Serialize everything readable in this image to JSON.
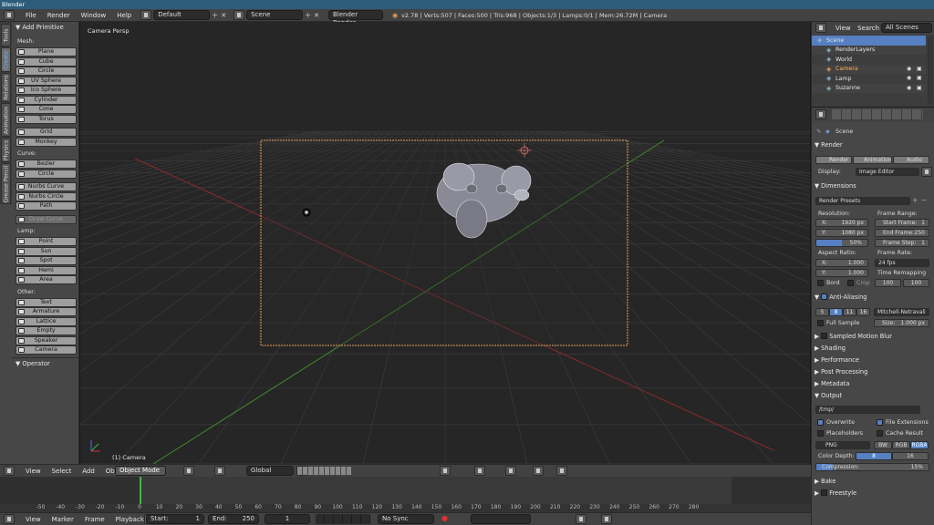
{
  "title": "Blender",
  "infobar": {
    "menus": [
      "File",
      "Render",
      "Window",
      "Help"
    ],
    "layout": "Default",
    "scene": "Scene",
    "engine": "Blender Render",
    "stats": "v2.78 | Verts:507 | Faces:500 | Tris:968 | Objects:1/3 | Lamps:0/1 | Mem:26.72M | Camera"
  },
  "toolshelf": {
    "tabs": [
      "Tools",
      "Create",
      "Relations",
      "Animation",
      "Physics",
      "Grease Pencil"
    ],
    "active_tab": "Create",
    "panel_title": "Add Primitive",
    "sections": [
      {
        "label": "Mesh:",
        "items": [
          "Plane",
          "Cube",
          "Circle",
          "UV Sphere",
          "Ico Sphere",
          "Cylinder",
          "Cone",
          "Torus"
        ]
      },
      {
        "label": "",
        "items": [
          "Grid",
          "Monkey"
        ]
      },
      {
        "label": "Curve:",
        "items": [
          "Bezier",
          "Circle"
        ]
      },
      {
        "label": "",
        "items": [
          "Nurbs Curve",
          "Nurbs Circle",
          "Path"
        ]
      },
      {
        "label": "",
        "items": [
          "Draw Curve"
        ]
      },
      {
        "label": "Lamp:",
        "items": [
          "Point",
          "Sun",
          "Spot",
          "Hemi",
          "Area"
        ]
      },
      {
        "label": "Other:",
        "items": [
          "Text",
          "Armature",
          "Lattice",
          "Empty",
          "Speaker",
          "Camera"
        ]
      }
    ],
    "operator_title": "Operator"
  },
  "viewport": {
    "view_name": "Camera Persp",
    "object_label": "(1) Camera"
  },
  "view3d_header": {
    "menus": [
      "View",
      "Select",
      "Add",
      "Object"
    ],
    "mode": "Object Mode",
    "orientation": "Global"
  },
  "timeline": {
    "ticks": [
      -50,
      -40,
      -30,
      -20,
      -10,
      0,
      10,
      20,
      30,
      40,
      50,
      60,
      70,
      80,
      90,
      100,
      110,
      120,
      130,
      140,
      150,
      160,
      170,
      180,
      190,
      200,
      210,
      220,
      230,
      240,
      250,
      260,
      270,
      280
    ],
    "current_frame": 1,
    "menus": [
      "View",
      "Marker",
      "Frame",
      "Playback"
    ],
    "start_label": "Start:",
    "start": "1",
    "end_label": "End:",
    "end": "250",
    "frame": "1",
    "sync": "No Sync"
  },
  "outliner": {
    "menus": [
      "View",
      "Search"
    ],
    "filter": "All Scenes",
    "items": [
      {
        "label": "Scene",
        "depth": 0
      },
      {
        "label": "RenderLayers",
        "depth": 1
      },
      {
        "label": "World",
        "depth": 1
      },
      {
        "label": "Camera",
        "depth": 1
      },
      {
        "label": "Lamp",
        "depth": 1
      },
      {
        "label": "Suzanne",
        "depth": 1
      }
    ]
  },
  "properties": {
    "breadcrumb": "Scene",
    "render_header": "Render",
    "render_btn": "Render",
    "animation_btn": "Animation",
    "audio_btn": "Audio",
    "display_label": "Display:",
    "display_value": "Image Editor",
    "dimensions_header": "Dimensions",
    "render_presets": "Render Presets",
    "resolution_label": "Resolution:",
    "res_x_label": "X:",
    "res_x": "1920 px",
    "res_y_label": "Y:",
    "res_y": "1080 px",
    "res_pct": "50%",
    "res_pct_fraction": 0.5,
    "frame_range_label": "Frame Range:",
    "start_frame_label": "Start Frame:",
    "start_frame": "1",
    "end_frame_label": "End Frame:",
    "end_frame": "250",
    "frame_step_label": "Frame Step:",
    "frame_step": "1",
    "aspect_label": "Aspect Ratio:",
    "aspect_x_label": "X:",
    "aspect_x": "1.000",
    "aspect_y_label": "Y:",
    "aspect_y": "1.000",
    "frame_rate_label": "Frame Rate:",
    "frame_rate": "24 fps",
    "time_remap_label": "Time Remapping",
    "remap_old": "100",
    "remap_new": "100",
    "bord": "Bord",
    "crop": "Crop",
    "aa_header": "Anti-Aliasing",
    "aa_samples": [
      "5",
      "8",
      "11",
      "16"
    ],
    "aa_active": "8",
    "aa_filter": "Mitchell-Netravali",
    "full_sample": "Full Sample",
    "size_label": "Size:",
    "size_value": "1.000 px",
    "collapsed": [
      "Sampled Motion Blur",
      "Shading",
      "Performance",
      "Post Processing",
      "Metadata"
    ],
    "output_header": "Output",
    "output_path": "/tmp/",
    "overwrite": "Overwrite",
    "file_ext": "File Extensions",
    "placeholders": "Placeholders",
    "cache_result": "Cache Result",
    "format": "PNG",
    "color_modes": [
      "BW",
      "RGB",
      "RGBA"
    ],
    "color_active": "RGBA",
    "color_depth_label": "Color Depth:",
    "depths": [
      "8",
      "16"
    ],
    "depth_active": "8",
    "compression_label": "Compression:",
    "compression": "15%",
    "compression_fraction": 0.15,
    "bake": "Bake",
    "freestyle": "Freestyle"
  },
  "colors": {
    "accent": "#5680c2",
    "camera_frame": "#e8a35a",
    "grid_line": "#3a3a3a",
    "x_axis": "#8a2a2a",
    "y_axis": "#3f8a2a",
    "timeline_cursor": "#3fba3f"
  }
}
